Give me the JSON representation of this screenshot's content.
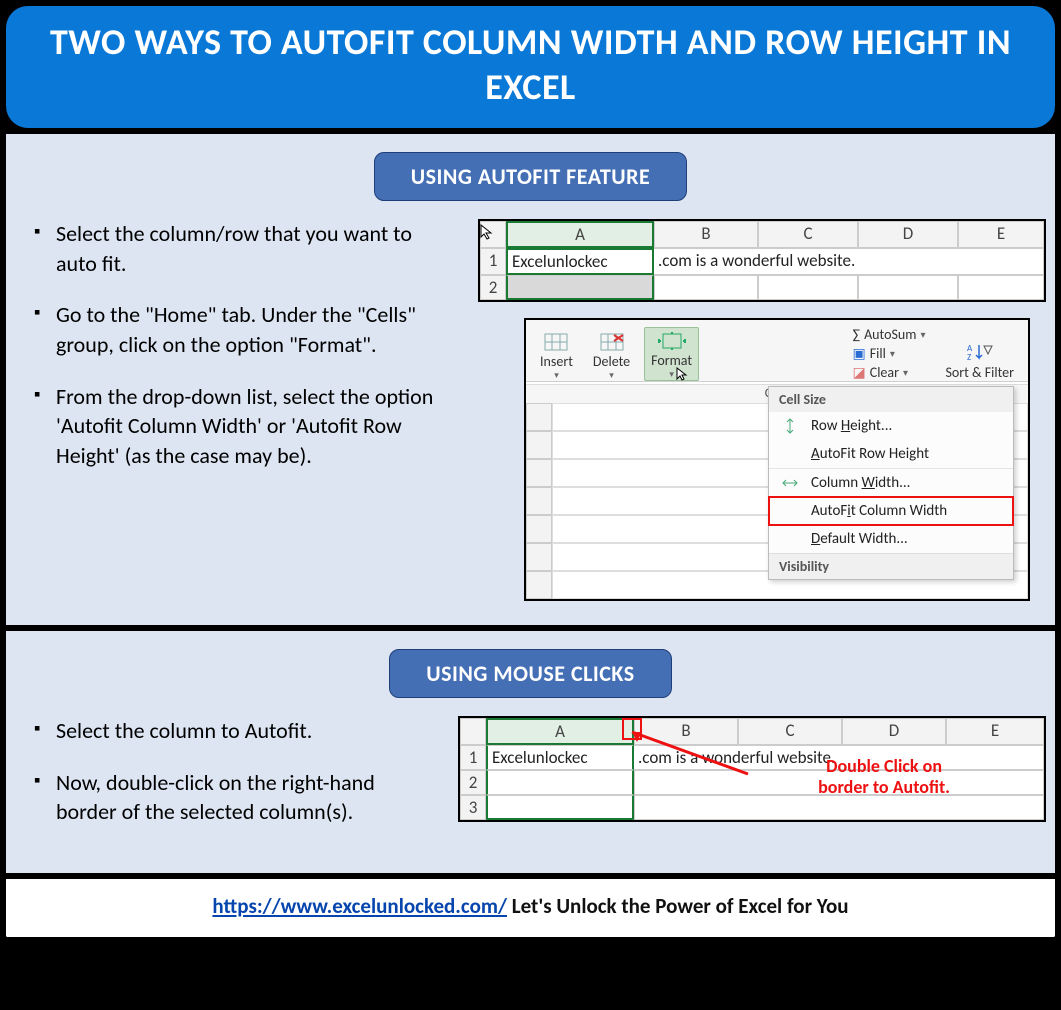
{
  "title": "TWO WAYS TO AUTOFIT COLUMN WIDTH AND ROW HEIGHT IN EXCEL",
  "section1": {
    "badge": "USING AUTOFIT FEATURE",
    "steps": [
      "Select the column/row that you want to auto fit.",
      "Go to the \"Home\" tab. Under the \"Cells\" group, click on the option \"Format\".",
      "From the drop-down list, select the option 'Autofit Column Width' or 'Autofit Row Height' (as the case may be)."
    ],
    "sheet": {
      "cols": [
        "A",
        "B",
        "C",
        "D",
        "E"
      ],
      "row1_text_left": "Excelunlockec",
      "row1_text_right": ".com is a wonderful website.",
      "row_nums": [
        "1",
        "2"
      ]
    },
    "ribbon": {
      "insert": "Insert",
      "delete": "Delete",
      "format": "Format",
      "group": "Cells",
      "autosum": "AutoSum",
      "fill": "Fill",
      "clear": "Clear",
      "sort": "Sort & Filter",
      "sheet_col": "O"
    },
    "menu": {
      "hd1": "Cell Size",
      "row_height": "Row Height...",
      "autofit_row": "AutoFit Row Height",
      "col_width": "Column Width...",
      "autofit_col": "AutoFit Column Width",
      "default_w": "Default Width...",
      "hd2": "Visibility"
    }
  },
  "section2": {
    "badge": "USING MOUSE CLICKS",
    "steps": [
      "Select the column to Autofit.",
      "Now, double-click on the right-hand border of the selected column(s)."
    ],
    "sheet": {
      "cols": [
        "A",
        "B",
        "C",
        "D",
        "E"
      ],
      "row1_text_left": "Excelunlockec",
      "row1_text_right": ".com is a wonderful website.",
      "row_nums": [
        "1",
        "2",
        "3"
      ],
      "callout_l1": "Double Click on",
      "callout_l2": "border to Autofit."
    }
  },
  "footer": {
    "link_text": "https://www.excelunlocked.com/",
    "tail": " Let's Unlock the Power of Excel for You"
  }
}
